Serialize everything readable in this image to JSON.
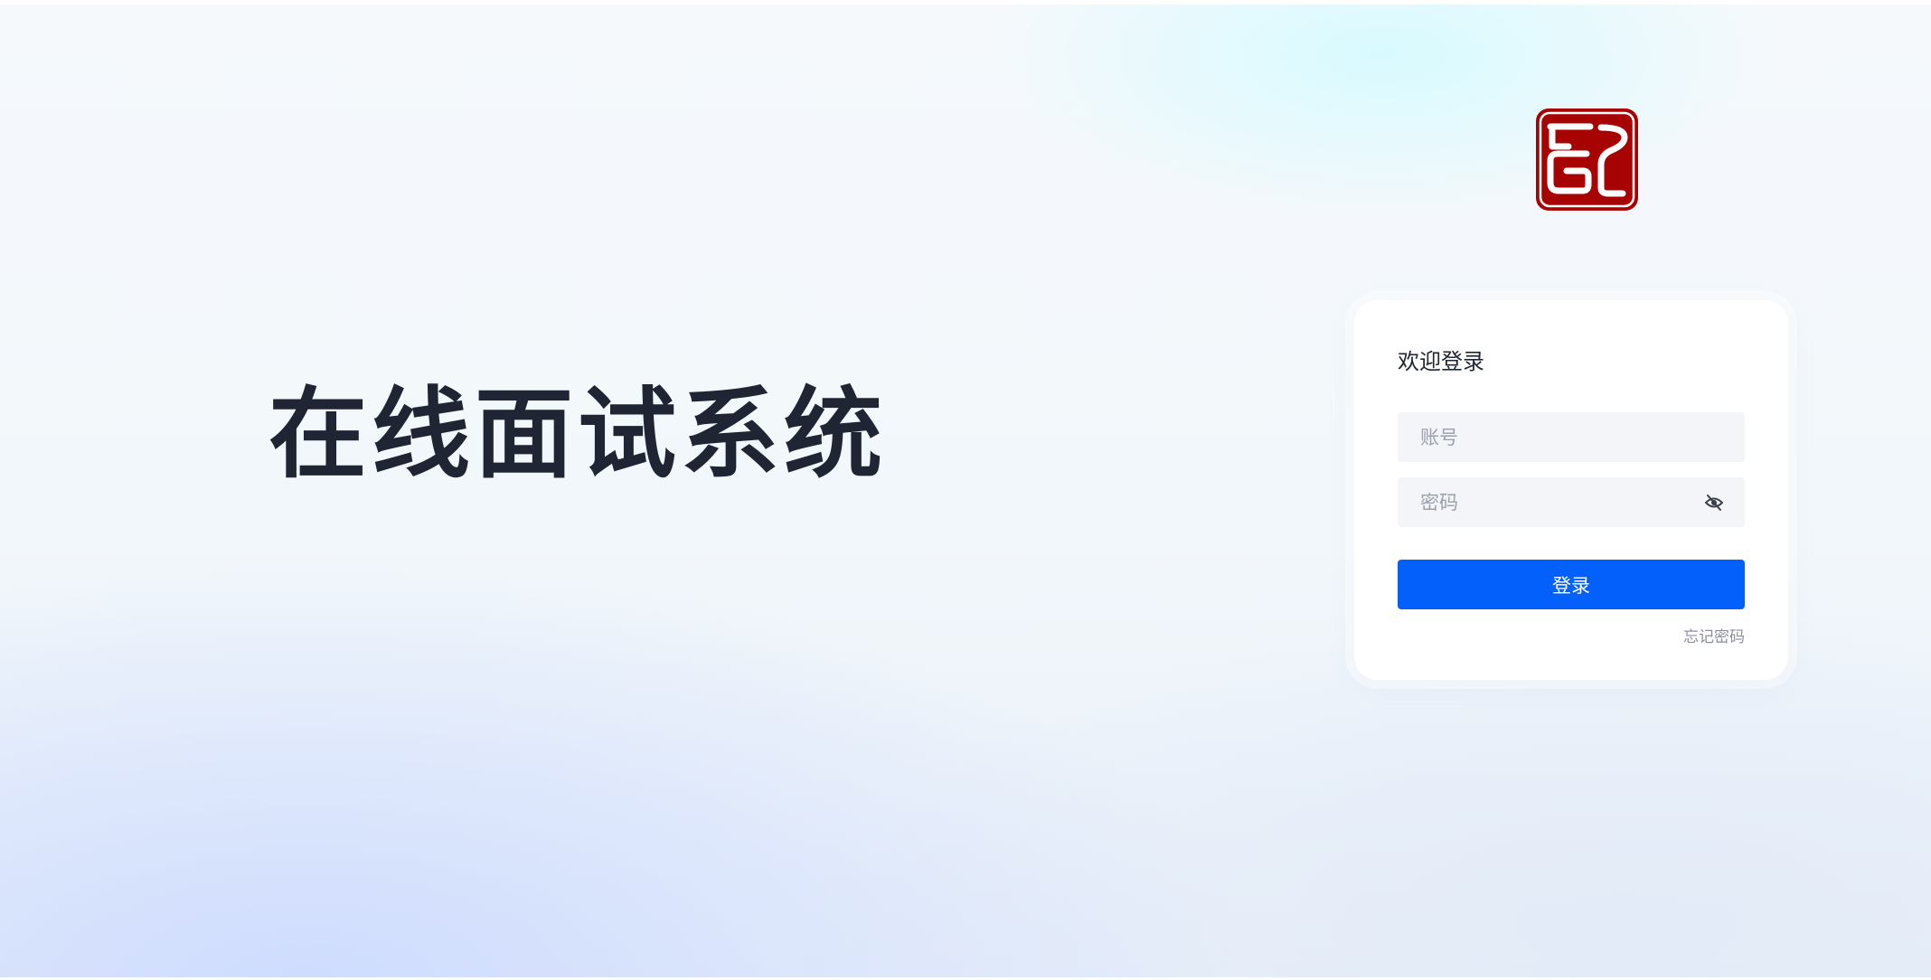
{
  "app": {
    "title": "在线面试系统"
  },
  "logo": {
    "icon": "seal-logo",
    "color": "#a80303"
  },
  "login": {
    "title": "欢迎登录",
    "account_placeholder": "账号",
    "account_value": "",
    "password_placeholder": "密码",
    "password_value": "",
    "password_toggle_icon": "eye-slash-icon",
    "submit_label": "登录",
    "forgot_label": "忘记密码"
  },
  "colors": {
    "primary": "#0360fb",
    "title_text": "#1f2533",
    "muted_text": "#8a919c",
    "input_background": "#f3f5f8"
  }
}
